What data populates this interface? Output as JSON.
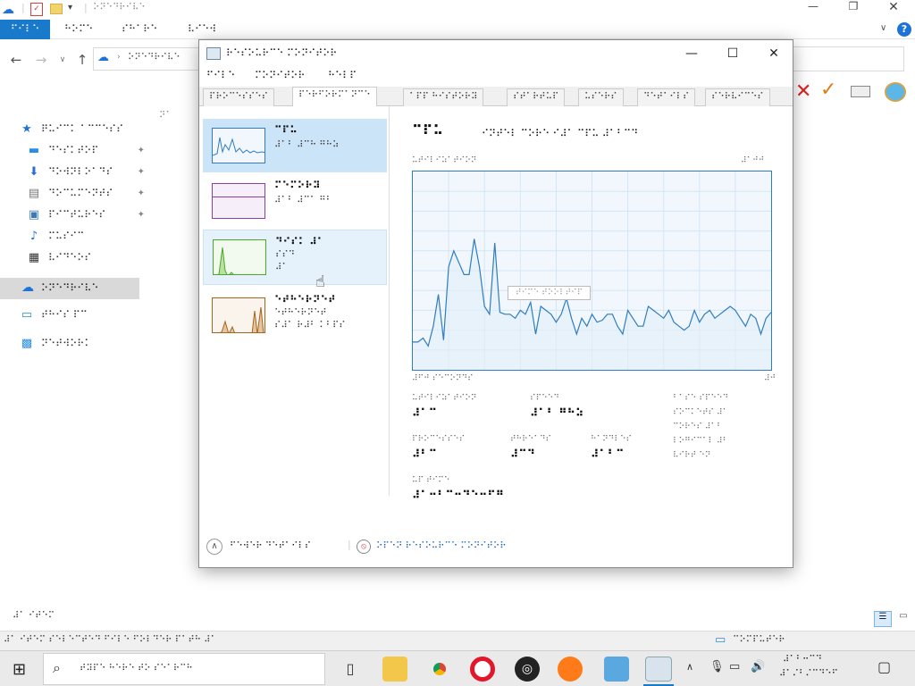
{
  "explorer": {
    "qat_title": "⠕⠝⠑⠙⠗⠊⠧⠑",
    "ribbon_tabs": [
      "⠋⠊⠇⠑",
      "⠓⠕⠍⠑",
      "⠎⠓⠁⠗⠑",
      "⠧⠊⠑⠺"
    ],
    "address_text": "⠕⠝⠑⠙⠗⠊⠧⠑",
    "column_header": "⠝⠁",
    "quick_access": "⠟⠥⠊⠉⠅ ⠁⠉⠉⠑⠎⠎",
    "nav_items": [
      {
        "label": "⠙⠑⠎⠅⠞⠕⠏",
        "icon": "desktop-icon"
      },
      {
        "label": "⠙⠕⠺⠝⠇⠕⠁⠙⠎",
        "icon": "download-icon"
      },
      {
        "label": "⠙⠕⠉⠥⠍⠑⠝⠞⠎",
        "icon": "document-icon"
      },
      {
        "label": "⠏⠊⠉⠞⠥⠗⠑⠎",
        "icon": "picture-icon"
      },
      {
        "label": "⠍⠥⠎⠊⠉",
        "icon": "music-icon"
      },
      {
        "label": "⠧⠊⠙⠑⠕⠎",
        "icon": "video-icon"
      }
    ],
    "onedrive": "⠕⠝⠑⠙⠗⠊⠧⠑",
    "this_pc": "⠞⠓⠊⠎ ⠏⠉",
    "network": "⠝⠑⠞⠺⠕⠗⠅",
    "item_count": "⠼⠁ ⠊⠞⠑⠍",
    "hint_text": "⠼⠁ ⠊⠞⠑⠍ ⠎⠑⠇⠑⠉⠞⠑⠙ ⠋⠊⠇⠑ ⠋⠕⠇⠙⠑⠗ ⠏⠁⠞⠓ ⠼⠁",
    "computer_label": "⠉⠕⠍⠏⠥⠞⠑⠗"
  },
  "rm": {
    "title": "⠗⠑⠎⠕⠥⠗⠉⠑ ⠍⠕⠝⠊⠞⠕⠗",
    "menu": [
      "⠋⠊⠇⠑",
      "⠍⠕⠝⠊⠞⠕⠗",
      "⠓⠑⠇⠏"
    ],
    "tabs": [
      "⠏⠗⠕⠉⠑⠎⠎⠑⠎",
      "⠏⠑⠗⠋⠕⠗⠍⠁⠝⠉⠑",
      "⠁⠏⠏ ⠓⠊⠎⠞⠕⠗⠽",
      "⠎⠞⠁⠗⠞⠥⠏",
      "⠥⠎⠑⠗⠎",
      "⠙⠑⠞⠁⠊⠇⠎",
      "⠎⠑⠗⠧⠊⠉⠑⠎"
    ],
    "tiles": [
      {
        "title": "⠉⠏⠥",
        "sub1": "⠼⠁⠃ ⠼⠉⠓ ⠛⠓⠵",
        "sub2": ""
      },
      {
        "title": "⠍⠑⠍⠕⠗⠽",
        "sub1": "⠼⠁⠃ ⠼⠉⠁ ⠛⠃",
        "sub2": ""
      },
      {
        "title": "⠙⠊⠎⠅ ⠼⠁",
        "sub1": "⠎⠎⠙",
        "sub2": "⠼⠁"
      },
      {
        "title": "⠑⠞⠓⠑⠗⠝⠑⠞",
        "sub1": "⠑⠞⠓⠑⠗⠝⠑⠞",
        "sub2": "⠎⠼⠁ ⠗⠼⠃ ⠅⠃⠏⠎"
      }
    ],
    "main_title": "⠉⠏⠥",
    "main_name": "⠊⠝⠞⠑⠇ ⠉⠕⠗⠑ ⠊⠼⠁ ⠉⠏⠥ ⠼⠁⠃⠉⠙",
    "axis_top_left": "⠥⠞⠊⠇⠊⠵⠁⠞⠊⠕⠝",
    "axis_top_right": "⠼⠁⠚⠚",
    "axis_bottom_left": "⠼⠋⠚ ⠎⠑⠉⠕⠝⠙⠎",
    "axis_bottom_right": "⠼⠚",
    "graph_overlay": "⠞⠊⠍⠑ ⠞⠕⠕⠇⠞⠊⠏",
    "stats": [
      {
        "label": "⠥⠞⠊⠇⠊⠵⠁⠞⠊⠕⠝",
        "value": "⠼⠁⠉"
      },
      {
        "label": "⠎⠏⠑⠑⠙",
        "value": "⠼⠁⠃ ⠛⠓⠵"
      },
      {
        "label": "⠏⠗⠕⠉⠑⠎⠎⠑⠎",
        "value": "⠼⠃⠉"
      },
      {
        "label": "⠞⠓⠗⠑⠁⠙⠎",
        "value": "⠼⠉⠙"
      },
      {
        "label": "⠓⠁⠝⠙⠇⠑⠎",
        "value": "⠼⠁⠃⠉"
      },
      {
        "label": "⠥⠏ ⠞⠊⠍⠑",
        "value": "⠼⠁⠒⠃⠉⠒⠙⠑⠒⠋⠛"
      }
    ],
    "base_speed": "⠃⠁⠎⠑ ⠎⠏⠑⠑⠙",
    "sockets": "⠎⠕⠉⠅⠑⠞⠎ ⠼⠁",
    "cores": "⠉⠕⠗⠑⠎ ⠼⠁⠃",
    "logical": "⠇⠕⠛⠊⠉⠁⠇ ⠼⠃",
    "virt": "⠧⠊⠗⠞ ⠑⠝",
    "fewer_details": "⠋⠑⠺⠑⠗ ⠙⠑⠞⠁⠊⠇⠎",
    "open_monitor": "⠕⠏⠑⠝ ⠗⠑⠎⠕⠥⠗⠉⠑ ⠍⠕⠝⠊⠞⠕⠗"
  },
  "taskbar": {
    "search_placeholder": "⠞⠽⠏⠑ ⠓⠑⠗⠑ ⠞⠕ ⠎⠑⠁⠗⠉⠓",
    "time": "⠼⠁⠃⠒⠉⠙",
    "date": "⠼⠁⠌⠃⠌⠉⠙⠑⠋"
  },
  "chart_data": {
    "type": "line",
    "ylim": [
      0,
      100
    ],
    "values": [
      14,
      14,
      16,
      12,
      22,
      38,
      15,
      52,
      60,
      54,
      48,
      48,
      66,
      52,
      32,
      28,
      64,
      29,
      28,
      28,
      26,
      30,
      28,
      34,
      18,
      32,
      30,
      28,
      24,
      28,
      36,
      26,
      18,
      26,
      22,
      28,
      24,
      25,
      28,
      28,
      22,
      18,
      30,
      26,
      22,
      22,
      32,
      30,
      28,
      26,
      30,
      24,
      22,
      20,
      22,
      30,
      24,
      28,
      30,
      26,
      28,
      30,
      32,
      30,
      26,
      22,
      28,
      26,
      18,
      26,
      29
    ]
  },
  "colors": {
    "accent": "#1979ca",
    "graph_line": "#2f7dbf",
    "graph_bg": "#f1f7fd"
  }
}
